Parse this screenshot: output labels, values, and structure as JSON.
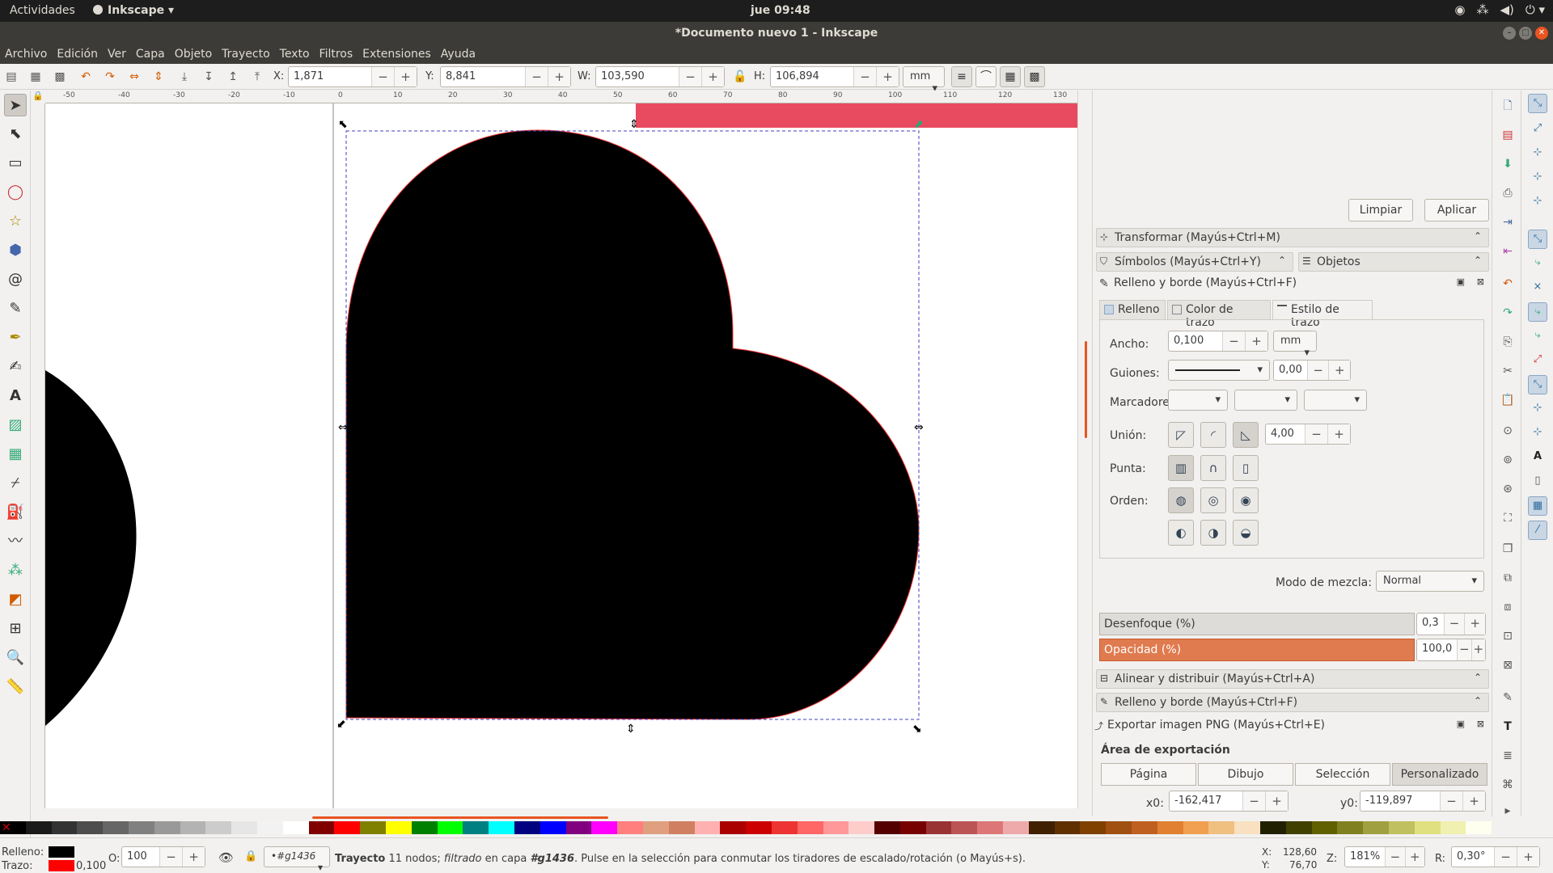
{
  "topbar": {
    "activities": "Actividades",
    "app_name": "Inkscape ▾",
    "clock": "jue 09:48",
    "tray_icons": [
      "steam-icon",
      "network-icon",
      "volume-icon",
      "power-icon"
    ]
  },
  "window": {
    "title": "*Documento nuevo 1 - Inkscape"
  },
  "menu": [
    "Archivo",
    "Edición",
    "Ver",
    "Capa",
    "Objeto",
    "Trayecto",
    "Texto",
    "Filtros",
    "Extensiones",
    "Ayuda"
  ],
  "toolbar": {
    "x_label": "X:",
    "x_value": "1,871",
    "y_label": "Y:",
    "y_value": "8,841",
    "w_label": "W:",
    "w_value": "103,590",
    "h_label": "H:",
    "h_value": "106,894",
    "unit": "mm",
    "minus": "−",
    "plus": "+"
  },
  "ruler_ticks": [
    "-50",
    "-40",
    "-30",
    "-20",
    "-10",
    "0",
    "10",
    "20",
    "30",
    "40",
    "50",
    "60",
    "70",
    "80",
    "90",
    "100",
    "110",
    "120",
    "130"
  ],
  "dock": {
    "clear_button": "Limpiar",
    "apply_button": "Aplicar",
    "transform_header": "Transformar (Mayús+Ctrl+M)",
    "symbols_header": "Símbolos (Mayús+Ctrl+Y)",
    "objects_header": "Objetos",
    "fillstroke_header": "Relleno y borde (Mayús+Ctrl+F)",
    "tabs": [
      "Relleno",
      "Color de trazo",
      "Estilo de trazo"
    ],
    "width_label": "Ancho:",
    "width_value": "0,100",
    "width_unit": "mm",
    "dashes_label": "Guiones:",
    "dash_offset": "0,00",
    "markers_label": "Marcadores:",
    "join_label": "Unión:",
    "miter_value": "4,00",
    "cap_label": "Punta:",
    "order_label": "Orden:",
    "blend_label": "Modo de mezcla:",
    "blend_value": "Normal",
    "blur_label": "Desenfoque (%)",
    "blur_value": "0,3",
    "opacity_label": "Opacidad (%)",
    "opacity_value": "100,0",
    "align_header": "Alinear y distribuir (Mayús+Ctrl+A)",
    "fillstroke_header2": "Relleno y borde (Mayús+Ctrl+F)",
    "export_header": "Exportar imagen PNG (Mayús+Ctrl+E)",
    "export_area_title": "Área de exportación",
    "export_modes": [
      "Página",
      "Dibujo",
      "Selección",
      "Personalizado"
    ],
    "x0_label": "x0:",
    "x0_value": "-162,417",
    "y0_label": "y0:",
    "y0_value": "-119,897"
  },
  "status": {
    "fill_label": "Relleno:",
    "stroke_label": "Trazo:",
    "stroke_width": "0,100",
    "opacity_label": "O:",
    "opacity_value": "100",
    "layer": "•#g1436",
    "msg_type": "Trayecto",
    "msg_nodes": " 11 nodos; ",
    "msg_filtered": "filtrado",
    "msg_in_layer": " en capa ",
    "msg_layer": "#g1436",
    "msg_rest": ". Pulse en la selección para conmutar los tiradores de escalado/rotación (o Mayús+s).",
    "x_label": "X:",
    "x_value": "128,60",
    "y_label": "Y:",
    "y_value": "76,70",
    "zoom_label": "Z:",
    "zoom_value": "181%",
    "rot_label": "R:",
    "rot_value": "0,30°"
  },
  "colors": {
    "accent": "#e95420",
    "fill": "#000000",
    "stroke": "#ff0000",
    "selection_rect": "#e84a5f"
  }
}
